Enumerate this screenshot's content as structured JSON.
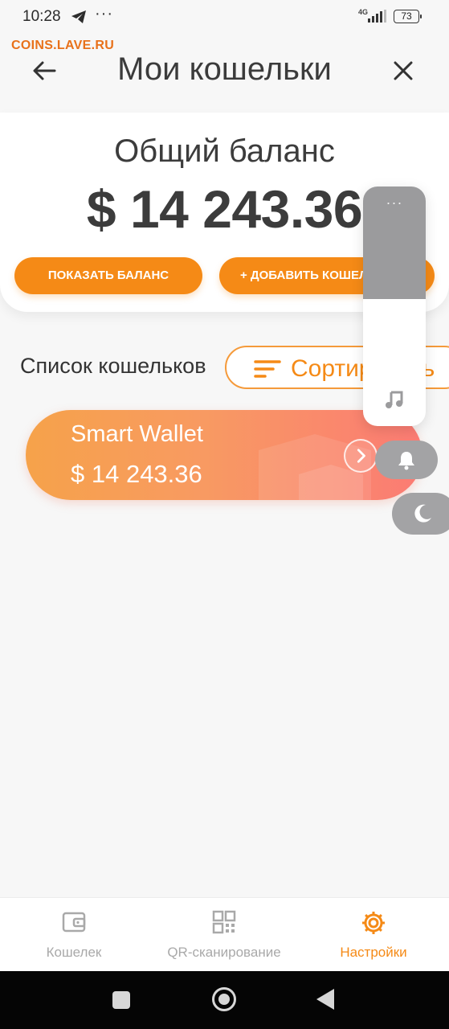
{
  "status_bar": {
    "time": "10:28",
    "more": "···",
    "network": "4G",
    "battery": "73"
  },
  "watermark": "COINS.LAVE.RU",
  "header": {
    "title": "Мои кошельки",
    "back_icon": "arrow-left-icon",
    "close_icon": "close-icon"
  },
  "balance": {
    "title": "Общий баланс",
    "amount": "$ 14 243.36",
    "show_button": "ПОКАЗАТЬ БАЛАНС",
    "add_button": "+ ДОБАВИТЬ КОШЕЛЕК"
  },
  "wallet_list": {
    "title": "Список кошельков",
    "sort_label": "Сортировать",
    "items": [
      {
        "name": "Smart Wallet",
        "balance": "$ 14 243.36"
      }
    ]
  },
  "overlay": {
    "dots": "···",
    "volume_level": 0.47,
    "icons": [
      "music-icon",
      "bell-icon",
      "moon-icon"
    ]
  },
  "bottom_nav": {
    "items": [
      {
        "label": "Кошелек",
        "icon": "wallet-icon",
        "active": false
      },
      {
        "label": "QR-сканирование",
        "icon": "qr-code-icon",
        "active": false
      },
      {
        "label": "Настройки",
        "icon": "gear-icon",
        "active": true
      }
    ]
  },
  "colors": {
    "accent": "#f58a16",
    "card_gradient_start": "#f6a24a",
    "card_gradient_end": "#fb7b74",
    "inactive": "#a9a9a9"
  }
}
